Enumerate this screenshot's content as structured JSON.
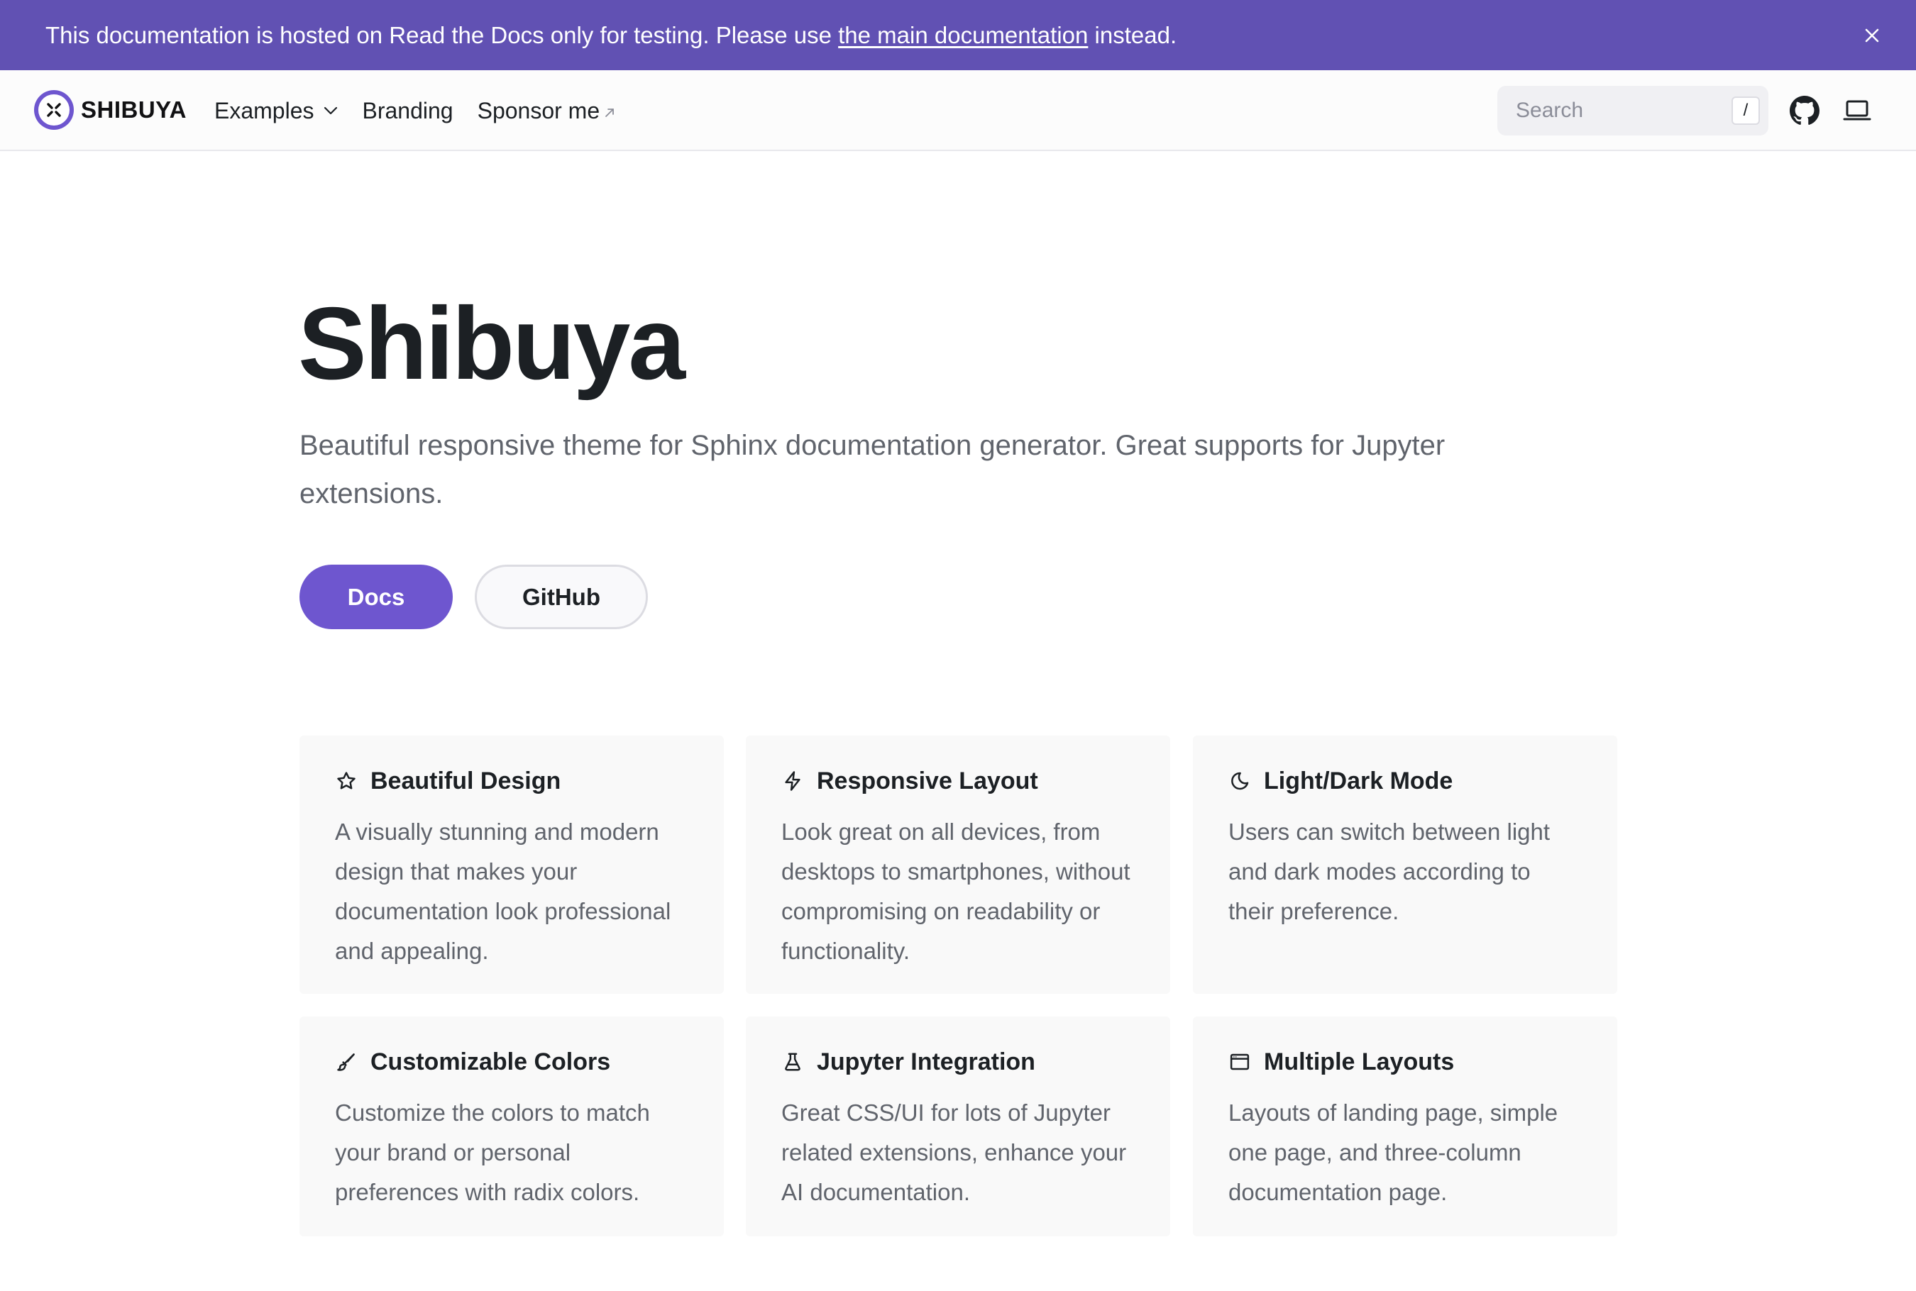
{
  "announcement": {
    "text_before": "This documentation is hosted on Read the Docs only for testing. Please use ",
    "link_text": "the main documentation",
    "text_after": " instead."
  },
  "header": {
    "logo_text": "SHIBUYA",
    "nav": {
      "examples": "Examples",
      "branding": "Branding",
      "sponsor": "Sponsor me"
    },
    "search_placeholder": "Search",
    "search_shortcut": "/"
  },
  "hero": {
    "title": "Shibuya",
    "description": "Beautiful responsive theme for Sphinx documentation generator. Great supports for Jupyter extensions.",
    "buttons": {
      "docs": "Docs",
      "github": "GitHub"
    }
  },
  "features": [
    {
      "icon": "star-icon",
      "title": "Beautiful Design",
      "text": "A visually stunning and modern design that makes your documentation look professional and appealing."
    },
    {
      "icon": "lightning-icon",
      "title": "Responsive Layout",
      "text": "Look great on all devices, from desktops to smartphones, without compromising on readability or functionality."
    },
    {
      "icon": "moon-icon",
      "title": "Light/Dark Mode",
      "text": "Users can switch between light and dark modes according to their preference."
    },
    {
      "icon": "brush-icon",
      "title": "Customizable Colors",
      "text": "Customize the colors to match your brand or personal preferences with radix colors."
    },
    {
      "icon": "flask-icon",
      "title": "Jupyter Integration",
      "text": "Great CSS/UI for lots of Jupyter related extensions, enhance your AI documentation."
    },
    {
      "icon": "browser-window-icon",
      "title": "Multiple Layouts",
      "text": "Layouts of landing page, simple one page, and three-column documentation page."
    }
  ],
  "colors": {
    "accent": "#6e56cf",
    "announcement_bg": "#6151b3",
    "card_bg": "#f9f9f9",
    "text": "#1c2024",
    "muted_text": "#60646c"
  }
}
